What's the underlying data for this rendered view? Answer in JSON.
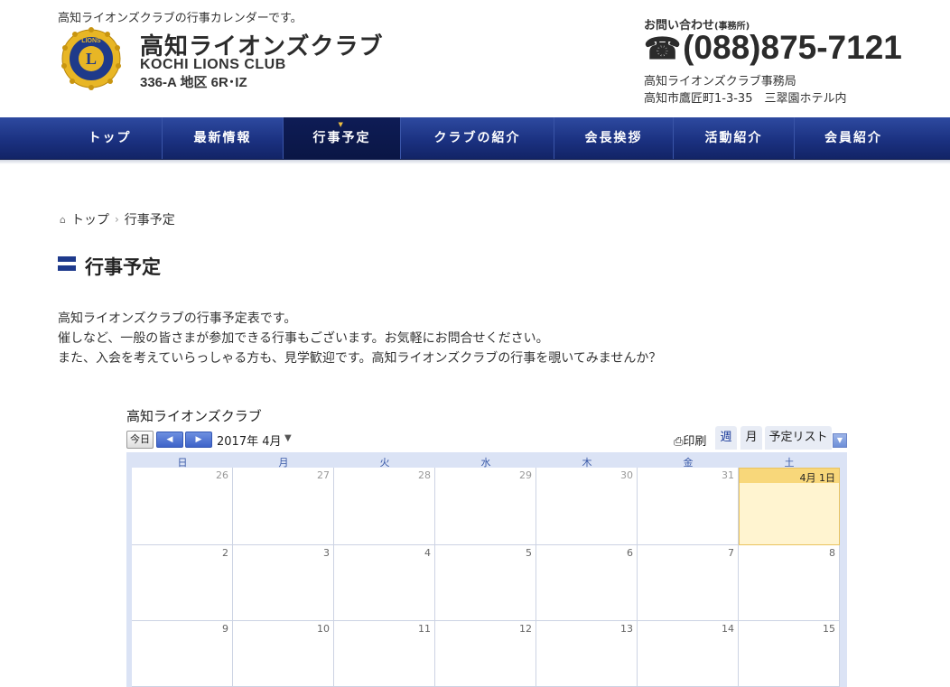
{
  "header": {
    "tagline": "高知ライオンズクラブの行事カレンダーです。",
    "title": "高知ライオンズクラブ",
    "subtitle_en": "KOCHI LIONS CLUB",
    "district": "336-A 地区 6R･IZ",
    "contact_label": "お問い合わせ",
    "contact_label_small": "(事務所)",
    "phone": "(088)875-7121",
    "office_name": "高知ライオンズクラブ事務局",
    "office_address": "高知市鷹匠町1-3-35　三翠園ホテル内",
    "logo_text": "LIONS"
  },
  "nav": {
    "items": [
      {
        "label": "トップ"
      },
      {
        "label": "最新情報"
      },
      {
        "label": "行事予定"
      },
      {
        "label": "クラブの紹介"
      },
      {
        "label": "会長挨拶"
      },
      {
        "label": "活動紹介"
      },
      {
        "label": "会員紹介"
      }
    ],
    "active": "行事予定"
  },
  "breadcrumb": {
    "home": "トップ",
    "separator": "›",
    "current": "行事予定"
  },
  "page": {
    "title": "行事予定",
    "intro": [
      "高知ライオンズクラブの行事予定表です。",
      "催しなど、一般の皆さまが参加できる行事もございます。お気軽にお問合せください。",
      "また、入会を考えていらっしゃる方も、見学歓迎です。高知ライオンズクラブの行事を覗いてみませんか？"
    ]
  },
  "calendar": {
    "name": "高知ライオンズクラブ",
    "today_label": "今日",
    "current_month": "2017年 4月",
    "print_label": "印刷",
    "tab_week": "週",
    "tab_month": "月",
    "tab_agenda": "予定リスト",
    "weekdays": [
      "日",
      "月",
      "火",
      "水",
      "木",
      "金",
      "土"
    ],
    "weeks": [
      [
        "26",
        "27",
        "28",
        "29",
        "30",
        "31",
        "4月 1日"
      ],
      [
        "2",
        "3",
        "4",
        "5",
        "6",
        "7",
        "8"
      ],
      [
        "9",
        "10",
        "11",
        "12",
        "13",
        "14",
        "15"
      ]
    ]
  },
  "colors": {
    "nav": "#1b3181",
    "accent": "#1e3a8c",
    "today": "#fff4d0"
  }
}
